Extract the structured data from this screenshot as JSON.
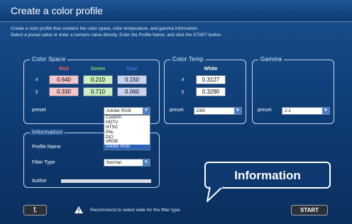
{
  "window": {
    "title": "Create a color profile"
  },
  "description": {
    "line1": "Create a color profile that contains the color space, color temperature, and gamma information.",
    "line2": "Select a preset value or enter a numeric value directly. Enter the Profile Name, and click the START button."
  },
  "color_space": {
    "label": "Color Space",
    "headers": {
      "red": "Red",
      "green": "Green",
      "blue": "Blue"
    },
    "x_label": "x",
    "y_label": "y",
    "x": {
      "red": "0.640",
      "green": "0.210",
      "blue": "0.150"
    },
    "y": {
      "red": "0.330",
      "green": "0.710",
      "blue": "0.060"
    },
    "preset_label": "preset",
    "preset_value": "Adobe RGB",
    "preset_options": [
      "Custom",
      "HDTV",
      "NTSC",
      "PAL",
      "DCI",
      "sRGB",
      "Adobe RGB"
    ]
  },
  "color_temp": {
    "label": "Color Temp",
    "header": "White",
    "x_label": "x",
    "y_label": "y",
    "x": "0.3127",
    "y": "0.3290",
    "preset_label": "preset",
    "preset_value": "D65"
  },
  "gamma": {
    "label": "Gamma",
    "preset_label": "preset",
    "preset_value": "2.2"
  },
  "information": {
    "label": "Information",
    "profile_name_label": "Profile Name",
    "filter_type_label": "Filter Type",
    "filter_type_value": "Normal",
    "author_label": "Author"
  },
  "callout": {
    "text": "Information"
  },
  "footer": {
    "back_label": "⮤",
    "warning_text": "Recommend to select wide for the filter type.",
    "start_label": "START"
  },
  "colors": {
    "background": "#0f3e78",
    "red_header": "#ff5a5a",
    "green_header": "#6fe06f",
    "blue_header": "#3f6fe0",
    "accent": "#2a64b8"
  }
}
